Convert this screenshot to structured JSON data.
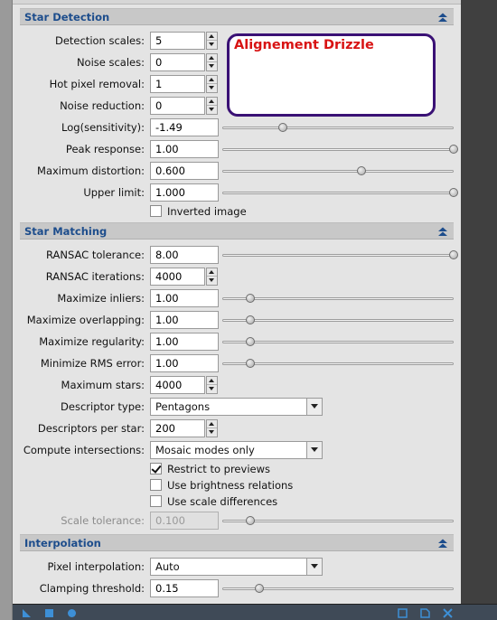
{
  "sections": {
    "star_detection": {
      "title": "Star Detection",
      "collapse_icon": "collapse-up-icon"
    },
    "star_matching": {
      "title": "Star Matching",
      "collapse_icon": "collapse-up-icon"
    },
    "interpolation": {
      "title": "Interpolation",
      "collapse_icon": "collapse-up-icon"
    }
  },
  "annotation": {
    "text": "Alignement Drizzle",
    "color": "#d81313",
    "border_color": "#3a1175"
  },
  "star_detection": {
    "detection_scales": {
      "label": "Detection scales:",
      "value": "5"
    },
    "noise_scales": {
      "label": "Noise scales:",
      "value": "0"
    },
    "hot_pixel_removal": {
      "label": "Hot pixel removal:",
      "value": "1"
    },
    "noise_reduction": {
      "label": "Noise reduction:",
      "value": "0"
    },
    "log_sensitivity": {
      "label": "Log(sensitivity):",
      "value": "-1.49",
      "slider_fraction": 0.26
    },
    "peak_response": {
      "label": "Peak response:",
      "value": "1.00",
      "slider_fraction": 1.0
    },
    "maximum_distortion": {
      "label": "Maximum distortion:",
      "value": "0.600",
      "slider_fraction": 0.6
    },
    "upper_limit": {
      "label": "Upper limit:",
      "value": "1.000",
      "slider_fraction": 1.0
    },
    "inverted_image": {
      "label": "Inverted image",
      "checked": false
    }
  },
  "star_matching": {
    "ransac_tolerance": {
      "label": "RANSAC tolerance:",
      "value": "8.00",
      "slider_fraction": 1.0
    },
    "ransac_iterations": {
      "label": "RANSAC iterations:",
      "value": "4000"
    },
    "maximize_inliers": {
      "label": "Maximize inliers:",
      "value": "1.00",
      "slider_fraction": 0.12
    },
    "maximize_overlapping": {
      "label": "Maximize overlapping:",
      "value": "1.00",
      "slider_fraction": 0.12
    },
    "maximize_regularity": {
      "label": "Maximize regularity:",
      "value": "1.00",
      "slider_fraction": 0.12
    },
    "minimize_rms_error": {
      "label": "Minimize RMS error:",
      "value": "1.00",
      "slider_fraction": 0.12
    },
    "maximum_stars": {
      "label": "Maximum stars:",
      "value": "4000"
    },
    "descriptor_type": {
      "label": "Descriptor type:",
      "value": "Pentagons"
    },
    "descriptors_per_star": {
      "label": "Descriptors per star:",
      "value": "200"
    },
    "compute_intersections": {
      "label": "Compute intersections:",
      "value": "Mosaic modes only"
    },
    "restrict_to_previews": {
      "label": "Restrict to previews",
      "checked": true
    },
    "use_brightness_relations": {
      "label": "Use brightness relations",
      "checked": false
    },
    "use_scale_differences": {
      "label": "Use scale differences",
      "checked": false
    },
    "scale_tolerance": {
      "label": "Scale tolerance:",
      "value": "0.100",
      "slider_fraction": 0.12,
      "disabled": true
    }
  },
  "interpolation": {
    "pixel_interpolation": {
      "label": "Pixel interpolation:",
      "value": "Auto"
    },
    "clamping_threshold": {
      "label": "Clamping threshold:",
      "value": "0.15",
      "slider_fraction": 0.16
    }
  },
  "bottom_toolbar": {
    "icons": [
      "new-instance-triangle-icon",
      "apply-global-square-icon",
      "apply-circle-icon",
      "browse-documentation-icon",
      "edit-document-icon",
      "reset-icon"
    ]
  }
}
